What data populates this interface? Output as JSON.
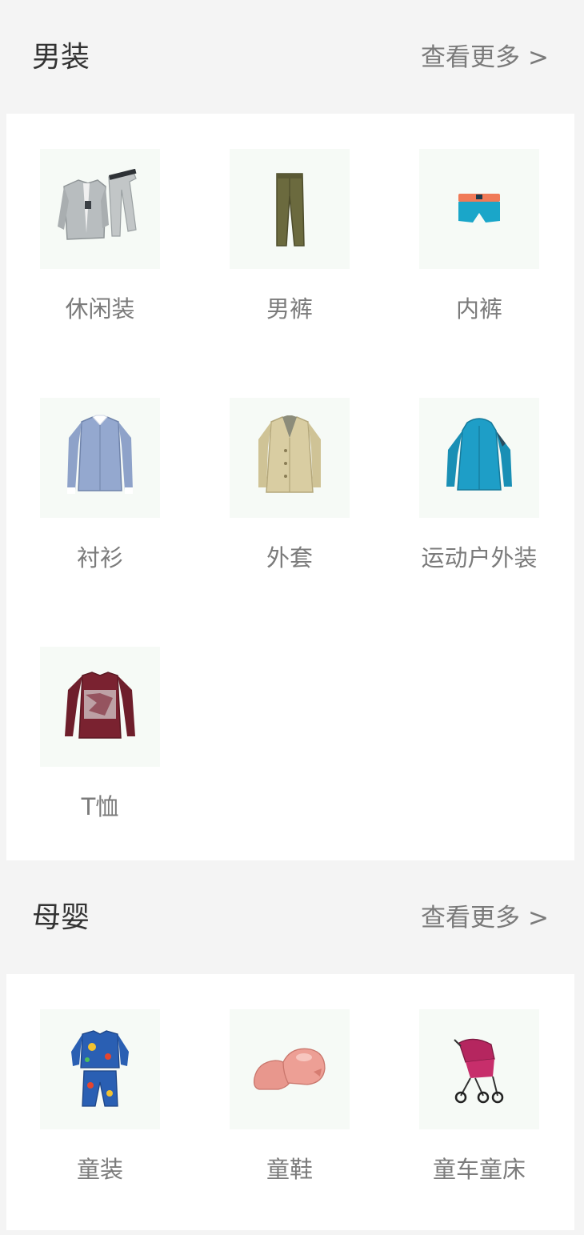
{
  "sections": [
    {
      "title": "男装",
      "more_label": "查看更多",
      "more_chevron": ">",
      "items": [
        {
          "label": "休闲装",
          "icon": "casual-wear-icon"
        },
        {
          "label": "男裤",
          "icon": "pants-icon"
        },
        {
          "label": "内裤",
          "icon": "underwear-icon"
        },
        {
          "label": "衬衫",
          "icon": "shirt-icon"
        },
        {
          "label": "外套",
          "icon": "coat-icon"
        },
        {
          "label": "运动户外装",
          "icon": "outdoor-jacket-icon"
        },
        {
          "label": "T恤",
          "icon": "tshirt-icon"
        }
      ]
    },
    {
      "title": "母婴",
      "more_label": "查看更多",
      "more_chevron": ">",
      "items": [
        {
          "label": "童装",
          "icon": "kids-clothes-icon"
        },
        {
          "label": "童鞋",
          "icon": "kids-shoes-icon"
        },
        {
          "label": "童车童床",
          "icon": "stroller-icon"
        }
      ]
    }
  ],
  "colors": {
    "page_background": "#f4f4f4",
    "card_background": "#ffffff",
    "thumb_background": "#f6faf6",
    "title_text": "#333333",
    "secondary_text": "#7a7a7a"
  }
}
